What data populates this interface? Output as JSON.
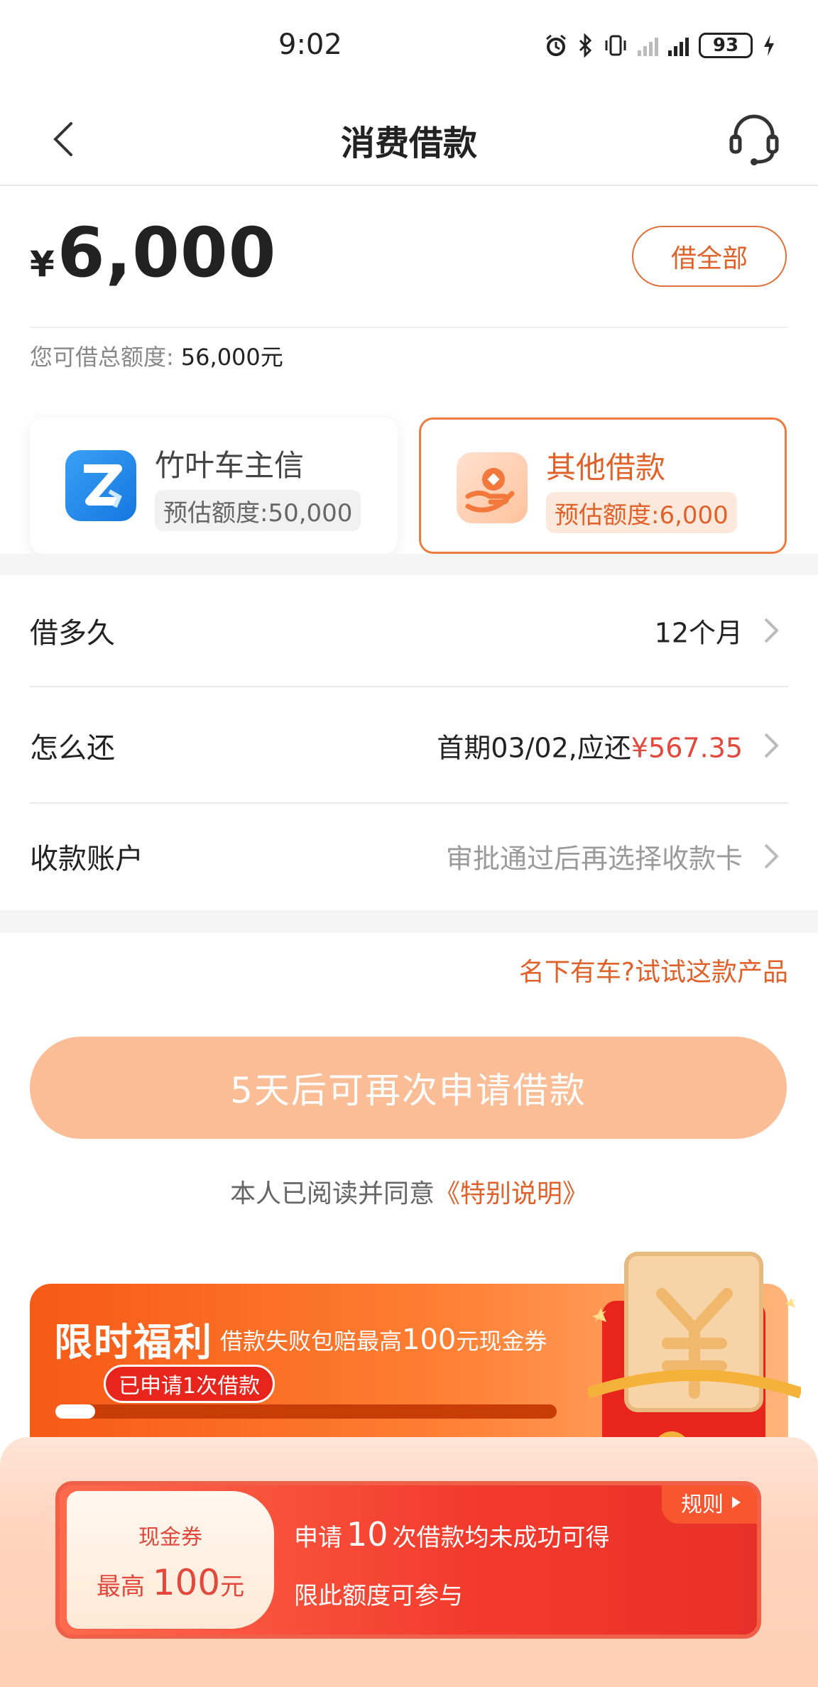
{
  "status_bar": {
    "time": "9:02",
    "battery": "93"
  },
  "nav": {
    "title": "消费借款"
  },
  "loan": {
    "currency": "¥",
    "amount": "6,000",
    "borrow_all_label": "借全部",
    "total_limit_label": "您可借总额度:",
    "total_limit_value": "56,000元"
  },
  "products": [
    {
      "name": "竹叶车主信",
      "limit": "预估额度:50,000",
      "selected": false,
      "icon": "z-app-icon"
    },
    {
      "name": "其他借款",
      "limit": "预估额度:6,000",
      "selected": true,
      "icon": "hand-coin-icon"
    }
  ],
  "rows": {
    "term": {
      "label": "借多久",
      "value": "12个月"
    },
    "repay": {
      "label": "怎么还",
      "value_prefix": "首期03/02,应还",
      "value_amount": "¥567.35"
    },
    "account": {
      "label": "收款账户",
      "value": "审批通过后再选择收款卡"
    }
  },
  "promo_link": "名下有车?试试这款产品",
  "apply_button": "5天后可再次申请借款",
  "agreement": {
    "prefix": "本人已阅读并同意",
    "link": "《特别说明》"
  },
  "benefit": {
    "title": "限时福利",
    "subtitle_prefix": "借款失败包赔最高",
    "subtitle_amount": "100",
    "subtitle_suffix": "元现金券",
    "tag": "已申请1次借款",
    "progress": 0.08
  },
  "coupon": {
    "label": "现金券",
    "max_prefix": "最高",
    "max_amount": "100",
    "max_unit": "元",
    "rules": "规则",
    "line1_prefix": "申请",
    "line1_count": "10",
    "line1_suffix": "次借款均未成功可得",
    "line2": "限此额度可参与"
  },
  "colors": {
    "accent": "#e0612a",
    "red": "#e4473b",
    "button_disabled": "#fbbd96"
  }
}
